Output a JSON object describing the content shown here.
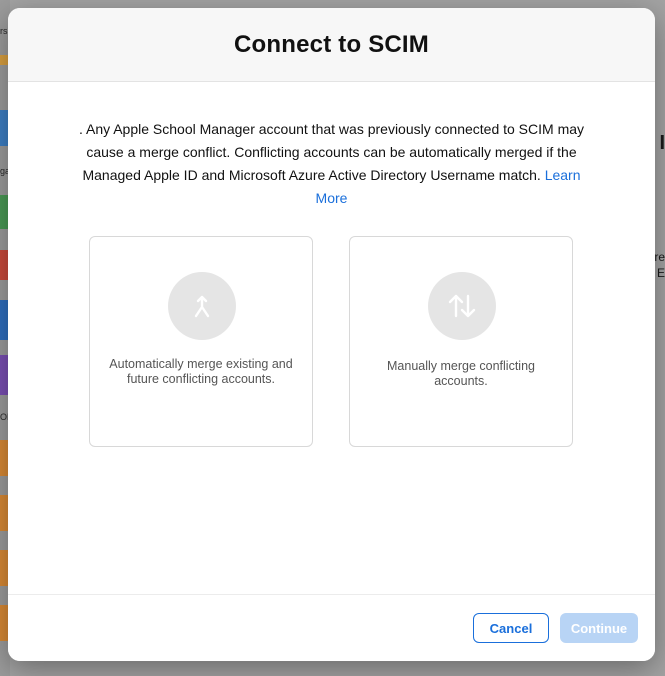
{
  "background": {
    "left_fragments": [
      "rs",
      "ga",
      "OM"
    ],
    "right_fragments": [
      "I",
      "re",
      "E"
    ]
  },
  "dialog": {
    "title": "Connect to SCIM",
    "intro_text": ". Any Apple School Manager account that was previously connected to SCIM may cause a merge conflict. Conflicting accounts can be automatically merged if the Managed Apple ID and Microsoft Azure Active Directory Username match.",
    "learn_more_label": "Learn More",
    "options": [
      {
        "icon": "merge-icon",
        "label": "Automatically merge existing and future conflicting accounts."
      },
      {
        "icon": "swap-arrows-icon",
        "label": "Manually merge conflicting accounts."
      }
    ],
    "buttons": {
      "cancel_label": "Cancel",
      "continue_label": "Continue"
    }
  },
  "colors": {
    "accent": "#1a6fdb",
    "continue_disabled": "#b8d4f5",
    "icon_circle": "#e5e5e5"
  }
}
